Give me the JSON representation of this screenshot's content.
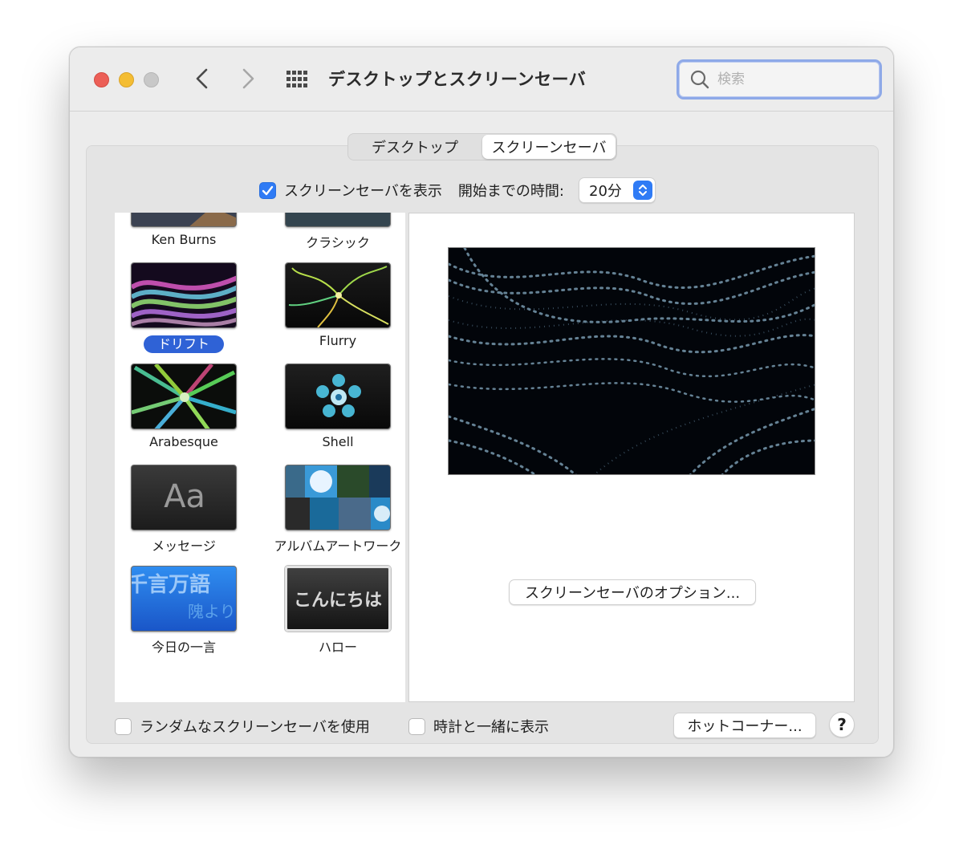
{
  "window": {
    "title": "デスクトップとスクリーンセーバ"
  },
  "search": {
    "placeholder": "検索"
  },
  "tabs": [
    {
      "label": "デスクトップ",
      "active": false
    },
    {
      "label": "スクリーンセーバ",
      "active": true
    }
  ],
  "show_screensaver": {
    "label": "スクリーンセーバを表示",
    "checked": true
  },
  "start_time": {
    "label": "開始までの時間:",
    "value": "20分"
  },
  "screensavers": [
    {
      "label": "Ken Burns",
      "icon": "mountain-thumbnail",
      "selected": false
    },
    {
      "label": "クラシック",
      "icon": "mountain-thumbnail",
      "selected": false
    },
    {
      "label": "ドリフト",
      "icon": "drift-thumbnail",
      "selected": true
    },
    {
      "label": "Flurry",
      "icon": "flurry-thumbnail",
      "selected": false
    },
    {
      "label": "Arabesque",
      "icon": "arabesque-thumbnail",
      "selected": false
    },
    {
      "label": "Shell",
      "icon": "shell-thumbnail",
      "selected": false
    },
    {
      "label": "メッセージ",
      "icon": "message-thumbnail",
      "thumb_text": "Aa",
      "selected": false
    },
    {
      "label": "アルバムアートワーク",
      "icon": "album-artwork-thumbnail",
      "selected": false
    },
    {
      "label": "今日の一言",
      "icon": "word-of-day-thumbnail",
      "thumb_text": "千言万語",
      "thumb_sub": "隗より",
      "selected": false
    },
    {
      "label": "ハロー",
      "icon": "hello-thumbnail",
      "thumb_text": "こんにちは",
      "selected": false
    }
  ],
  "preview": {
    "options_label": "スクリーンセーバのオプション..."
  },
  "random": {
    "label": "ランダムなスクリーンセーバを使用",
    "checked": false
  },
  "clock": {
    "label": "時計と一緒に表示",
    "checked": false
  },
  "hot_corners": {
    "label": "ホットコーナー..."
  },
  "help": {
    "label": "?"
  },
  "colors": {
    "accent": "#2f7bf5",
    "selection": "#2f62d6",
    "close": "#ec5f57",
    "minimize": "#f4bd33"
  }
}
